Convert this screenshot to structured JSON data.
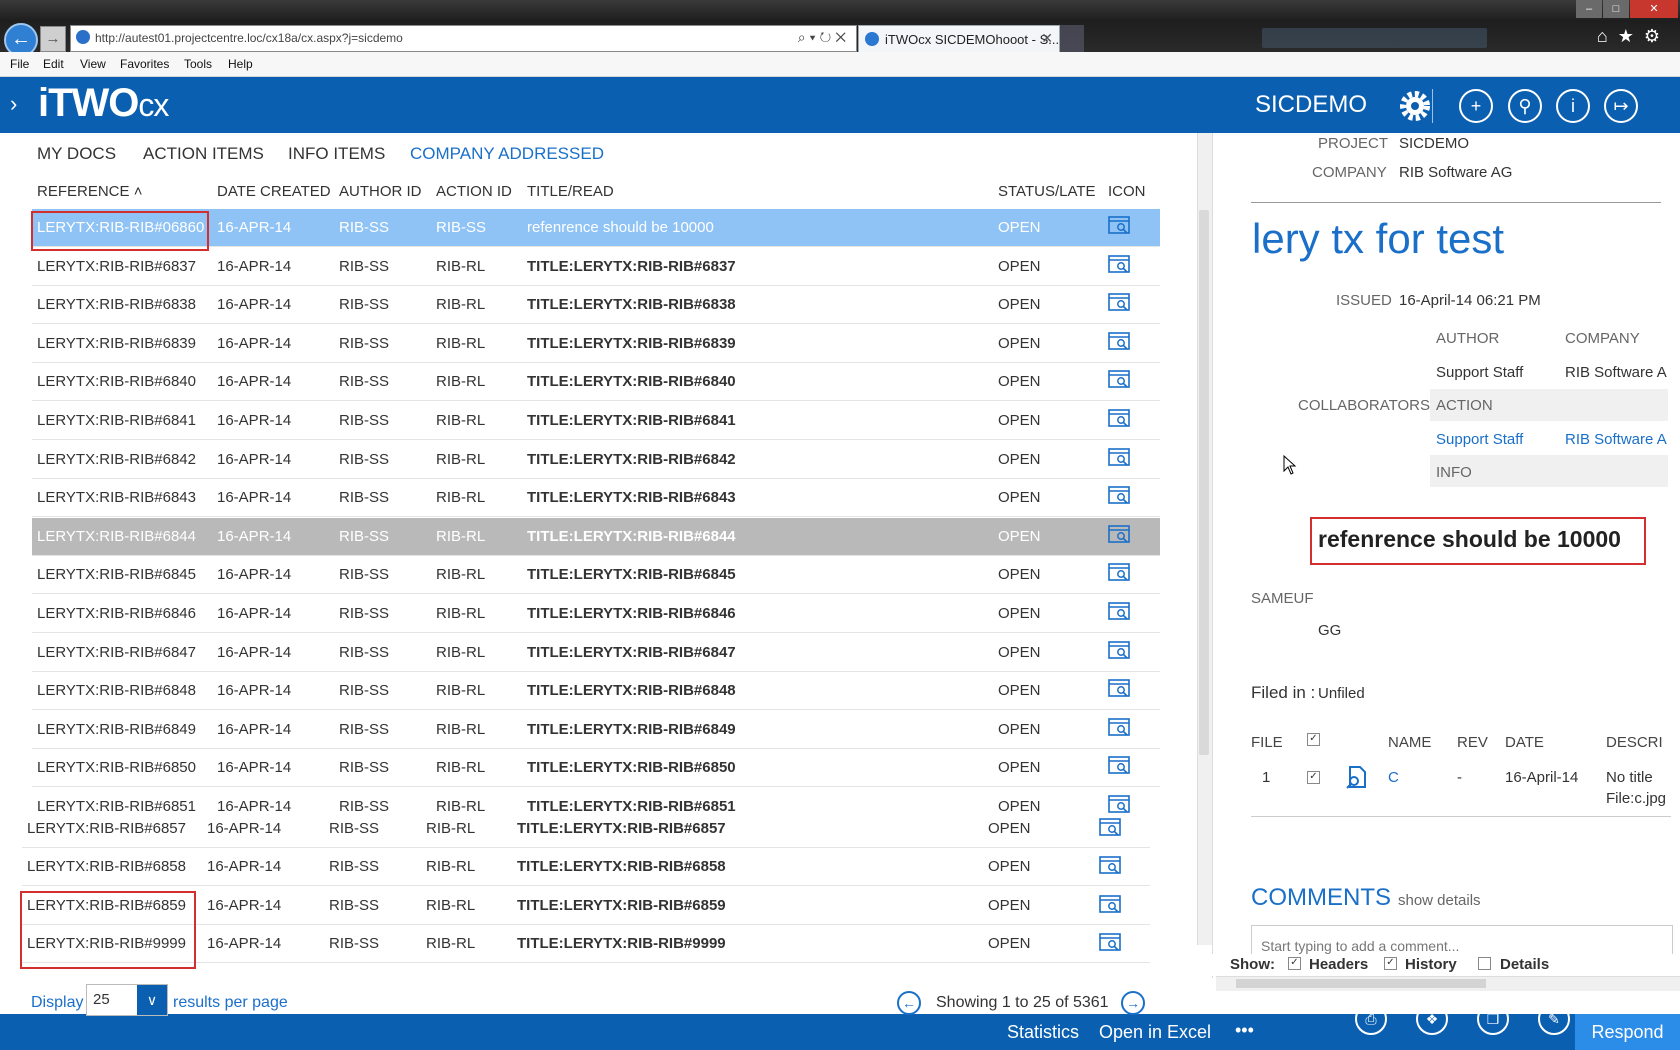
{
  "browser": {
    "url": "http://autest01.projectcentre.loc/cx18a/cx.aspx?j=sicdemo",
    "tab_title": "iTWOcx SICDEMOhooot - S...",
    "menu": [
      "File",
      "Edit",
      "View",
      "Favorites",
      "Tools",
      "Help"
    ]
  },
  "app": {
    "logo": "iTWO",
    "logo_suffix": "cx",
    "project": "SICDEMO"
  },
  "tabs": [
    "MY DOCS",
    "ACTION ITEMS",
    "INFO ITEMS",
    "COMPANY ADDRESSED"
  ],
  "columns": [
    "REFERENCE",
    "DATE CREATED",
    "AUTHOR ID",
    "ACTION ID",
    "TITLE/READ",
    "STATUS/LATE",
    "ICON"
  ],
  "rows": [
    {
      "ref": "LERYTX:RIB-RIB#06860",
      "date": "16-APR-14",
      "author": "RIB-SS",
      "action": "RIB-SS",
      "title": "refenrence should be 10000",
      "status": "OPEN"
    },
    {
      "ref": "LERYTX:RIB-RIB#6837",
      "date": "16-APR-14",
      "author": "RIB-SS",
      "action": "RIB-RL",
      "title": "TITLE:LERYTX:RIB-RIB#6837",
      "status": "OPEN"
    },
    {
      "ref": "LERYTX:RIB-RIB#6838",
      "date": "16-APR-14",
      "author": "RIB-SS",
      "action": "RIB-RL",
      "title": "TITLE:LERYTX:RIB-RIB#6838",
      "status": "OPEN"
    },
    {
      "ref": "LERYTX:RIB-RIB#6839",
      "date": "16-APR-14",
      "author": "RIB-SS",
      "action": "RIB-RL",
      "title": "TITLE:LERYTX:RIB-RIB#6839",
      "status": "OPEN"
    },
    {
      "ref": "LERYTX:RIB-RIB#6840",
      "date": "16-APR-14",
      "author": "RIB-SS",
      "action": "RIB-RL",
      "title": "TITLE:LERYTX:RIB-RIB#6840",
      "status": "OPEN"
    },
    {
      "ref": "LERYTX:RIB-RIB#6841",
      "date": "16-APR-14",
      "author": "RIB-SS",
      "action": "RIB-RL",
      "title": "TITLE:LERYTX:RIB-RIB#6841",
      "status": "OPEN"
    },
    {
      "ref": "LERYTX:RIB-RIB#6842",
      "date": "16-APR-14",
      "author": "RIB-SS",
      "action": "RIB-RL",
      "title": "TITLE:LERYTX:RIB-RIB#6842",
      "status": "OPEN"
    },
    {
      "ref": "LERYTX:RIB-RIB#6843",
      "date": "16-APR-14",
      "author": "RIB-SS",
      "action": "RIB-RL",
      "title": "TITLE:LERYTX:RIB-RIB#6843",
      "status": "OPEN"
    },
    {
      "ref": "LERYTX:RIB-RIB#6844",
      "date": "16-APR-14",
      "author": "RIB-SS",
      "action": "RIB-RL",
      "title": "TITLE:LERYTX:RIB-RIB#6844",
      "status": "OPEN"
    },
    {
      "ref": "LERYTX:RIB-RIB#6845",
      "date": "16-APR-14",
      "author": "RIB-SS",
      "action": "RIB-RL",
      "title": "TITLE:LERYTX:RIB-RIB#6845",
      "status": "OPEN"
    },
    {
      "ref": "LERYTX:RIB-RIB#6846",
      "date": "16-APR-14",
      "author": "RIB-SS",
      "action": "RIB-RL",
      "title": "TITLE:LERYTX:RIB-RIB#6846",
      "status": "OPEN"
    },
    {
      "ref": "LERYTX:RIB-RIB#6847",
      "date": "16-APR-14",
      "author": "RIB-SS",
      "action": "RIB-RL",
      "title": "TITLE:LERYTX:RIB-RIB#6847",
      "status": "OPEN"
    },
    {
      "ref": "LERYTX:RIB-RIB#6848",
      "date": "16-APR-14",
      "author": "RIB-SS",
      "action": "RIB-RL",
      "title": "TITLE:LERYTX:RIB-RIB#6848",
      "status": "OPEN"
    },
    {
      "ref": "LERYTX:RIB-RIB#6849",
      "date": "16-APR-14",
      "author": "RIB-SS",
      "action": "RIB-RL",
      "title": "TITLE:LERYTX:RIB-RIB#6849",
      "status": "OPEN"
    },
    {
      "ref": "LERYTX:RIB-RIB#6850",
      "date": "16-APR-14",
      "author": "RIB-SS",
      "action": "RIB-RL",
      "title": "TITLE:LERYTX:RIB-RIB#6850",
      "status": "OPEN"
    },
    {
      "ref": "LERYTX:RIB-RIB#6851",
      "date": "16-APR-14",
      "author": "RIB-SS",
      "action": "RIB-RL",
      "title": "TITLE:LERYTX:RIB-RIB#6851",
      "status": "OPEN"
    }
  ],
  "rows_bottom": [
    {
      "ref": "LERYTX:RIB-RIB#6857",
      "date": "16-APR-14",
      "author": "RIB-SS",
      "action": "RIB-RL",
      "title": "TITLE:LERYTX:RIB-RIB#6857",
      "status": "OPEN"
    },
    {
      "ref": "LERYTX:RIB-RIB#6858",
      "date": "16-APR-14",
      "author": "RIB-SS",
      "action": "RIB-RL",
      "title": "TITLE:LERYTX:RIB-RIB#6858",
      "status": "OPEN"
    },
    {
      "ref": "LERYTX:RIB-RIB#6859",
      "date": "16-APR-14",
      "author": "RIB-SS",
      "action": "RIB-RL",
      "title": "TITLE:LERYTX:RIB-RIB#6859",
      "status": "OPEN"
    },
    {
      "ref": "LERYTX:RIB-RIB#9999",
      "date": "16-APR-14",
      "author": "RIB-SS",
      "action": "RIB-RL",
      "title": "TITLE:LERYTX:RIB-RIB#9999",
      "status": "OPEN"
    }
  ],
  "pager": {
    "display_label": "Display",
    "per_page": "25",
    "per_page_label": "results per page",
    "showing": "Showing 1 to 25 of 5361"
  },
  "detail": {
    "project_label": "PROJECT",
    "project": "SICDEMO",
    "company_label": "COMPANY",
    "company": "RIB Software AG",
    "title": "lery tx for test",
    "issued_label": "ISSUED",
    "issued": "16-April-14 06:21 PM",
    "author_label": "AUTHOR",
    "company_col_label": "COMPANY",
    "author": "Support Staff",
    "author_company": "RIB Software A",
    "collaborators_label": "COLLABORATORS",
    "action_label": "ACTION",
    "action_person": "Support Staff",
    "action_company": "RIB Software A",
    "info_label": "INFO",
    "message": "refenrence should be 10000",
    "sameuf_label": "SAMEUF",
    "sameuf": "GG",
    "filed_in_label": "Filed in :",
    "filed_in": "Unfiled",
    "file_cols": [
      "FILE",
      "NAME",
      "REV",
      "DATE",
      "DESCRI"
    ],
    "file_row": {
      "num": "1",
      "name": "C",
      "rev": "-",
      "date": "16-April-14",
      "desc1": "No title",
      "desc2": "File:c.jpg"
    },
    "comments_label": "COMMENTS",
    "show_details": "show details",
    "comment_placeholder": "Start typing to add a comment...",
    "show_label": "Show:",
    "show_options": [
      "Headers",
      "History",
      "Details"
    ]
  },
  "footer": {
    "statistics": "Statistics",
    "open_excel": "Open in Excel",
    "more": "•••",
    "respond": "Respond"
  },
  "colors": {
    "brand_blue": "#0b5fb0",
    "link_blue": "#1a6fc9",
    "selected_row": "#8fc3f5",
    "highlight_row": "#b9b9b9",
    "annotation_red": "#d32f2f"
  }
}
